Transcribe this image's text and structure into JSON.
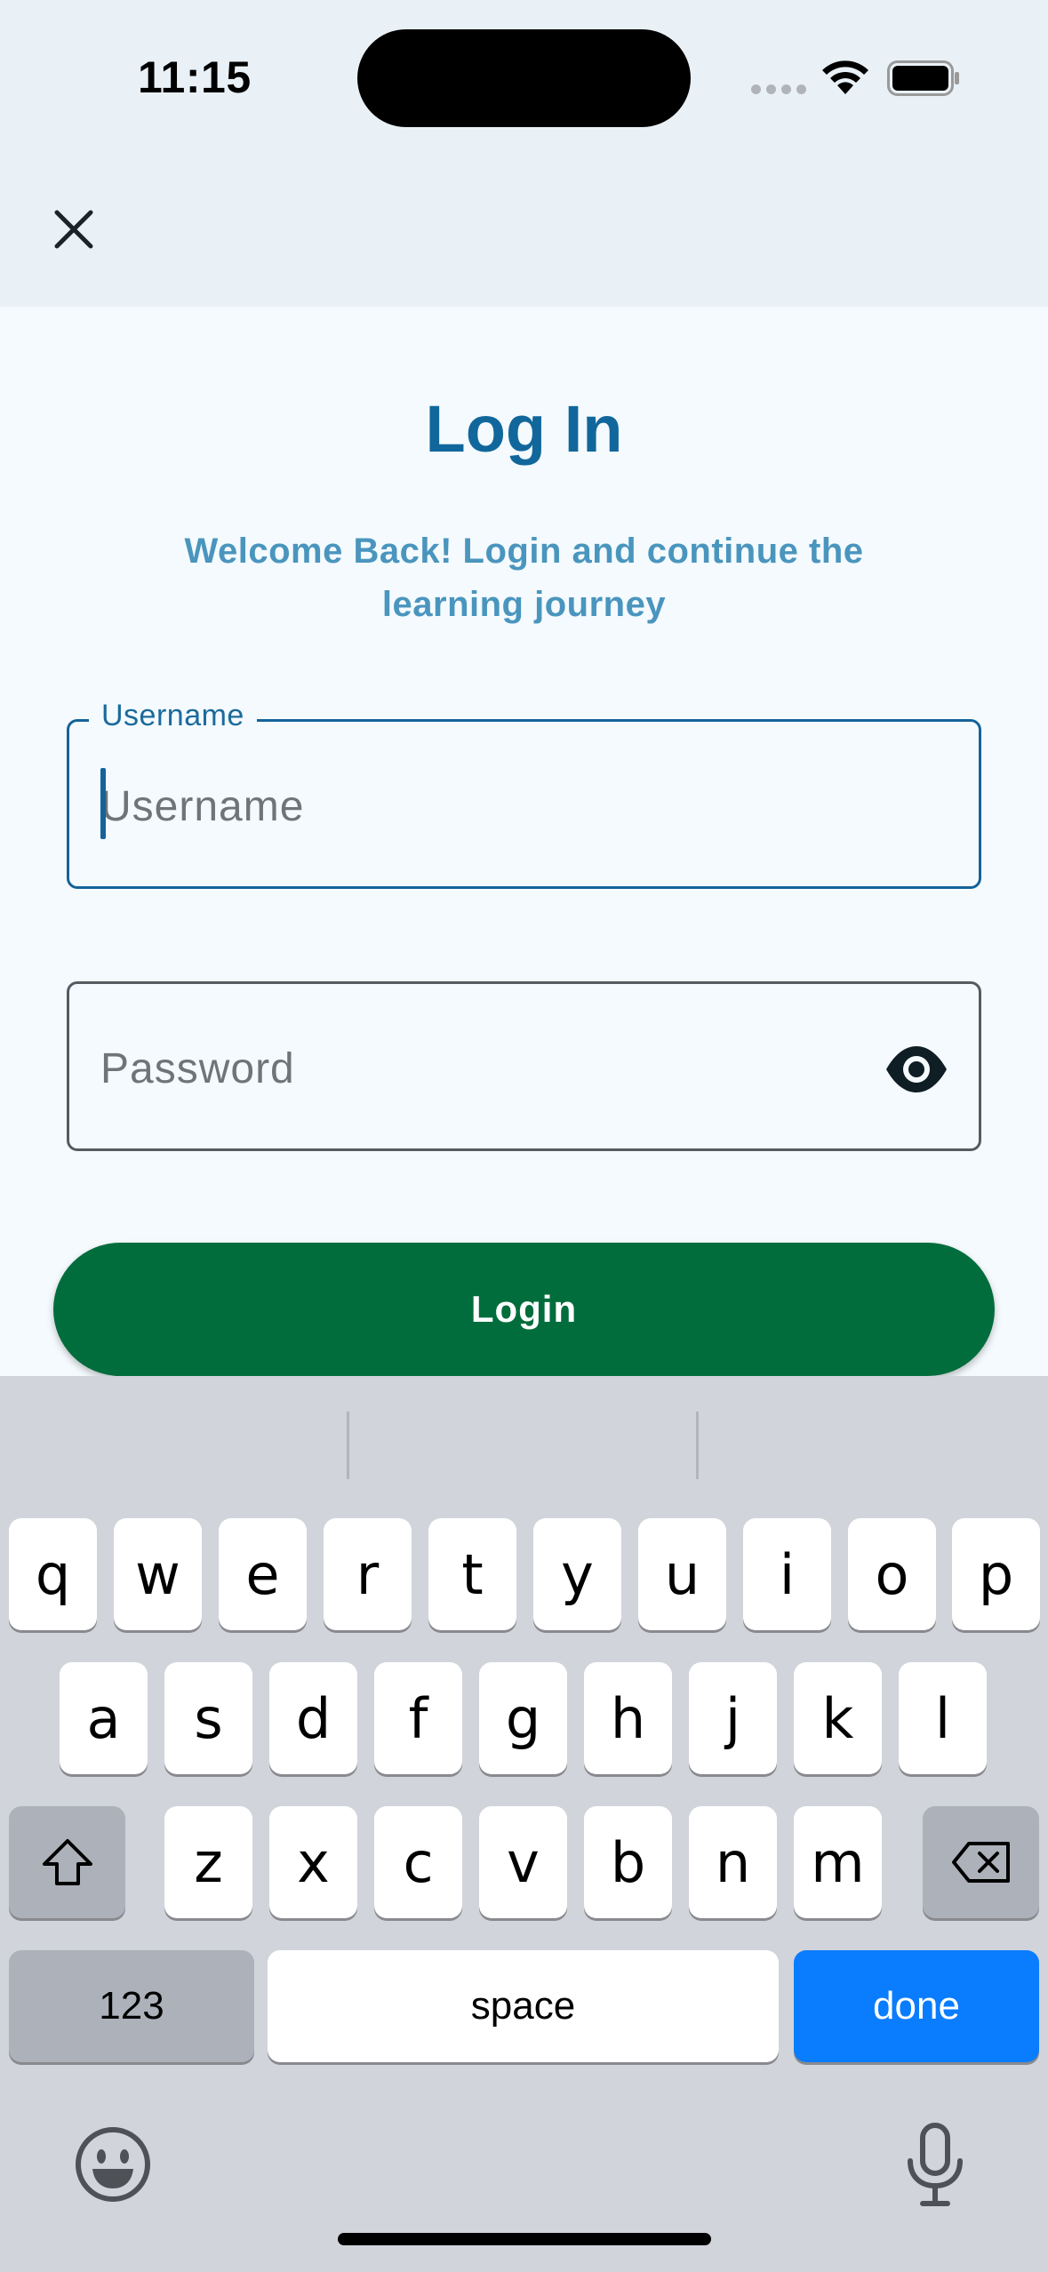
{
  "status_bar": {
    "time": "11:15"
  },
  "header": {
    "close_icon": "close-icon"
  },
  "main": {
    "title": "Log In",
    "subtitle": "Welcome Back! Login and continue the learning journey",
    "username": {
      "label": "Username",
      "placeholder": "Username",
      "value": ""
    },
    "password": {
      "placeholder": "Password",
      "value": "",
      "toggle_icon": "eye-icon"
    },
    "login_button": "Login"
  },
  "keyboard": {
    "row1": [
      "q",
      "w",
      "e",
      "r",
      "t",
      "y",
      "u",
      "i",
      "o",
      "p"
    ],
    "row2": [
      "a",
      "s",
      "d",
      "f",
      "g",
      "h",
      "j",
      "k",
      "l"
    ],
    "row3": [
      "z",
      "x",
      "c",
      "v",
      "b",
      "n",
      "m"
    ],
    "numbers_key": "123",
    "space_key": "space",
    "done_key": "done",
    "shift_icon": "shift-icon",
    "delete_icon": "backspace-icon",
    "emoji_icon": "emoji-icon",
    "mic_icon": "microphone-icon"
  },
  "colors": {
    "primary": "#11679b",
    "subtitle": "#4a95be",
    "login_button": "#016d3c",
    "done_key": "#0a7cfe"
  }
}
